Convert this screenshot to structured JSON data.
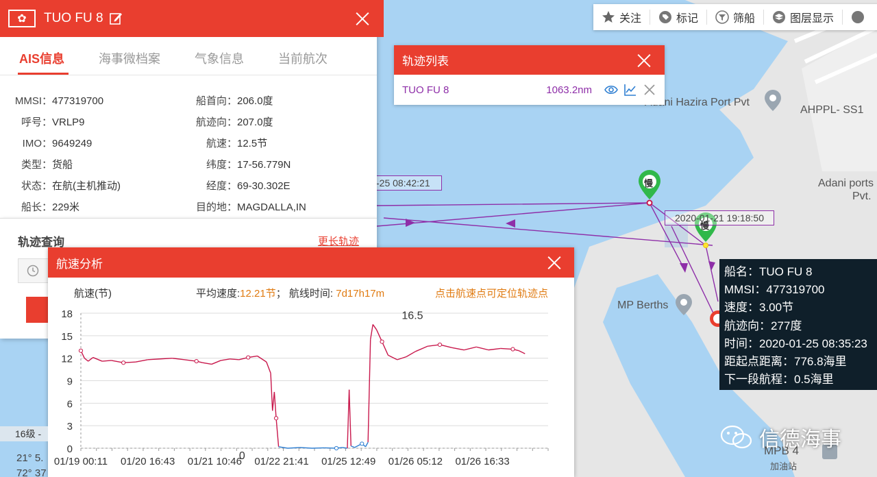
{
  "ship": {
    "name": "TUO FU 8",
    "flag_symbol": "✿",
    "tabs": [
      {
        "label": "AIS信息",
        "active": true
      },
      {
        "label": "海事微档案"
      },
      {
        "label": "气象信息"
      },
      {
        "label": "当前航次"
      }
    ],
    "left_fields": [
      {
        "key": "MMSI：",
        "value": "477319700"
      },
      {
        "key": "呼号：",
        "value": "VRLP9"
      },
      {
        "key": "IMO：",
        "value": "9649249"
      },
      {
        "key": "类型：",
        "value": "货船"
      },
      {
        "key": "状态：",
        "value": "在航(主机推动)"
      },
      {
        "key": "船长：",
        "value": "229米"
      }
    ],
    "right_fields": [
      {
        "key": "船首向：",
        "value": "206.0度"
      },
      {
        "key": "航迹向：",
        "value": "207.0度"
      },
      {
        "key": "航速：",
        "value": "12.5节"
      },
      {
        "key": "纬度：",
        "value": "17-56.779N"
      },
      {
        "key": "经度：",
        "value": "69-30.302E"
      },
      {
        "key": "目的地：",
        "value": "MAGDALLA,IN"
      }
    ]
  },
  "track_query": {
    "title": "轨迹查询",
    "longer_link": "更长轨迹"
  },
  "toolbar": [
    {
      "label": "关注",
      "icon": "star-icon"
    },
    {
      "label": "标记",
      "icon": "tag-icon"
    },
    {
      "label": "筛船",
      "icon": "filter-icon"
    },
    {
      "label": "图层显示",
      "icon": "layers-icon"
    }
  ],
  "track_list": {
    "title": "轨迹列表",
    "rows": [
      {
        "name": "TUO FU 8",
        "distance": "1063.2nm"
      }
    ]
  },
  "speed_panel": {
    "title": "航速分析",
    "unit": "航速(节)",
    "avg_label": "平均速度:",
    "avg_value": "12.21节",
    "sep": "；",
    "duration_label": "航线时间: ",
    "duration_value": "7d17h17m",
    "hint": "点击航速点可定位轨迹点"
  },
  "chart_data": {
    "type": "line",
    "title": "",
    "xlabel": "",
    "ylabel": "航速(节)",
    "ylim": [
      0,
      18
    ],
    "yticks": [
      0,
      3,
      6,
      9,
      12,
      15,
      18
    ],
    "grid": true,
    "xlim": [
      0,
      7.68
    ],
    "xtick_labels": [
      {
        "x": 0.0,
        "label": "01/19 00:11"
      },
      {
        "x": 1.1,
        "label": "01/20 16:43"
      },
      {
        "x": 2.2,
        "label": "01/21 10:46"
      },
      {
        "x": 3.3,
        "label": "01/22 21:41"
      },
      {
        "x": 4.4,
        "label": "01/25 12:49"
      },
      {
        "x": 5.5,
        "label": "01/26 05:12"
      },
      {
        "x": 6.6,
        "label": "01/26 16:33"
      }
    ],
    "annotations": [
      {
        "x": 5.45,
        "y": 16.5,
        "text": "16.5"
      },
      {
        "x": 2.65,
        "y": 0,
        "text": "0"
      }
    ],
    "series": [
      {
        "color": "#c8174b",
        "low_color": "#2f7fd2",
        "points": [
          [
            0.0,
            13.0
          ],
          [
            0.06,
            12.0
          ],
          [
            0.12,
            11.6
          ],
          [
            0.2,
            12.1
          ],
          [
            0.35,
            11.6
          ],
          [
            0.5,
            11.7
          ],
          [
            0.7,
            11.4
          ],
          [
            0.9,
            11.5
          ],
          [
            1.1,
            11.8
          ],
          [
            1.3,
            11.9
          ],
          [
            1.5,
            12.0
          ],
          [
            1.7,
            11.8
          ],
          [
            1.9,
            11.6
          ],
          [
            2.0,
            11.4
          ],
          [
            2.15,
            11.2
          ],
          [
            2.3,
            11.7
          ],
          [
            2.45,
            11.9
          ],
          [
            2.6,
            11.8
          ],
          [
            2.75,
            12.1
          ],
          [
            2.9,
            12.3
          ],
          [
            3.05,
            11.5
          ],
          [
            3.12,
            10.0
          ],
          [
            3.15,
            5.0
          ],
          [
            3.18,
            7.5
          ],
          [
            3.21,
            4.0
          ],
          [
            3.25,
            0.2
          ],
          [
            3.4,
            0.0
          ],
          [
            3.6,
            0.1
          ],
          [
            3.8,
            0.0
          ],
          [
            4.0,
            0.05
          ],
          [
            4.2,
            0.0
          ],
          [
            4.3,
            0.1
          ],
          [
            4.38,
            0.0
          ],
          [
            4.41,
            7.8
          ],
          [
            4.44,
            0.3
          ],
          [
            4.5,
            0.1
          ],
          [
            4.62,
            0.6
          ],
          [
            4.68,
            0.2
          ],
          [
            4.72,
            0.8
          ],
          [
            4.76,
            14.5
          ],
          [
            4.8,
            16.5
          ],
          [
            4.86,
            15.8
          ],
          [
            4.95,
            14.2
          ],
          [
            5.05,
            12.4
          ],
          [
            5.2,
            11.8
          ],
          [
            5.35,
            12.2
          ],
          [
            5.5,
            12.9
          ],
          [
            5.7,
            13.6
          ],
          [
            5.9,
            13.8
          ],
          [
            6.1,
            13.4
          ],
          [
            6.3,
            13.1
          ],
          [
            6.5,
            13.5
          ],
          [
            6.7,
            13.1
          ],
          [
            6.9,
            13.3
          ],
          [
            7.1,
            13.2
          ],
          [
            7.2,
            13.0
          ],
          [
            7.3,
            12.6
          ]
        ]
      }
    ]
  },
  "vessel_popup": [
    "船名：TUO FU 8",
    "MMSI：477319700",
    "速度：3.00节",
    "航迹向：277度",
    "时间：2020-01-25 08:35:23",
    "距起点距离：776.8海里",
    "下一段航程：0.5海里"
  ],
  "map": {
    "labels": [
      "Adani Hazira Port Pvt",
      "AHPPL- SS1",
      "Adani ports",
      "Pvt.",
      "MP Berths",
      "MPB 4",
      "加油站"
    ],
    "track_times": [
      "2020-01-21 19:18:50",
      "-25 08:42:21"
    ],
    "marker_text": "慢",
    "scale": "16级 -",
    "coords": [
      "21° 5.",
      "72° 37"
    ]
  },
  "watermark": "信德海事",
  "colors": {
    "brand_red": "#e93e2f",
    "track_purple": "#8e2ea8",
    "orange": "#e07b12"
  }
}
